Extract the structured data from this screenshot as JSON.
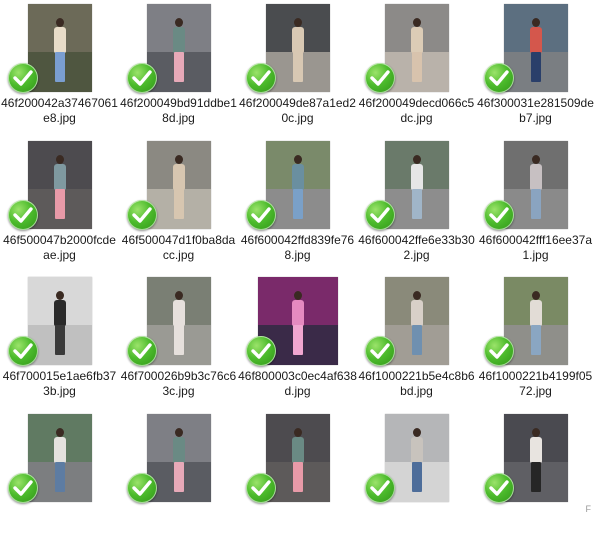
{
  "colors": {
    "check_fill": "#4cbb2c",
    "text": "#1a1a1a",
    "background": "#ffffff"
  },
  "icons": {
    "badge": "green-checkmark-icon"
  },
  "files": [
    {
      "name": "46f200042a37467061e8.jpg",
      "tones": [
        "#6c6a58",
        "#4f5640",
        "#e8dcc8",
        "#7a9ed0"
      ]
    },
    {
      "name": "46f200049bd91ddbe18d.jpg",
      "tones": [
        "#7e7f85",
        "#5a5c62",
        "#6a8a84",
        "#e7a9b8"
      ]
    },
    {
      "name": "46f200049de87a1ed20c.jpg",
      "tones": [
        "#4a4c4f",
        "#9a9690",
        "#d8c8b3",
        "#d8c8b3"
      ]
    },
    {
      "name": "46f200049decd066c5dc.jpg",
      "tones": [
        "#8c8a88",
        "#b9b2aa",
        "#dcccb6",
        "#d8c3ad"
      ]
    },
    {
      "name": "46f300031e281509deb7.jpg",
      "tones": [
        "#5c6f80",
        "#7a7e82",
        "#d4574c",
        "#2a3f6a"
      ]
    },
    {
      "name": "46f500047b2000fcdeae.jpg",
      "tones": [
        "#4d4b4f",
        "#5d5a5a",
        "#7f99a0",
        "#e89aa8"
      ]
    },
    {
      "name": "46f500047d1f0ba8dacc.jpg",
      "tones": [
        "#8b8982",
        "#b4b0a6",
        "#d7c6b0",
        "#d7c6b0"
      ]
    },
    {
      "name": "46f600042ffd839fe768.jpg",
      "tones": [
        "#7a8a6a",
        "#8c8c8c",
        "#6a8fa0",
        "#7aa0c8"
      ]
    },
    {
      "name": "46f600042ffe6e33b302.jpg",
      "tones": [
        "#6a7a6a",
        "#8d8d8d",
        "#e6e6e6",
        "#a0b5c8"
      ]
    },
    {
      "name": "46f600042fff16ee37a1.jpg",
      "tones": [
        "#6f6f6f",
        "#8a8a8a",
        "#c7c0c2",
        "#8aa4c0"
      ]
    },
    {
      "name": "46f700015e1ae6fb373b.jpg",
      "tones": [
        "#d8d8d8",
        "#c0c0c0",
        "#2a2a2a",
        "#3a3a3a"
      ]
    },
    {
      "name": "46f700026b9b3c76c63c.jpg",
      "tones": [
        "#7a7f74",
        "#9a9a94",
        "#e6e0dc",
        "#e6e0dc"
      ]
    },
    {
      "name": "46f800003c0ec4af638d.jpg",
      "tones": [
        "#7a2a6a",
        "#3a2a48",
        "#e58ac0",
        "#f0a6d0"
      ]
    },
    {
      "name": "46f1000221b5e4c8b6bd.jpg",
      "tones": [
        "#8a8a7a",
        "#a19d95",
        "#d8d0c8",
        "#6f90b0"
      ]
    },
    {
      "name": "46f1000221b4199f0572.jpg",
      "tones": [
        "#7a8a64",
        "#8f8f8a",
        "#e2dcd6",
        "#8aa6c2"
      ]
    },
    {
      "name": "",
      "tones": [
        "#607a62",
        "#7c7e80",
        "#e4e2de",
        "#5d7ca2"
      ]
    },
    {
      "name": "",
      "tones": [
        "#7e7f85",
        "#5a5c62",
        "#6a8a84",
        "#e7a9b8"
      ]
    },
    {
      "name": "",
      "tones": [
        "#4d4b4f",
        "#5d5a5a",
        "#6a8a84",
        "#e89aa8"
      ]
    },
    {
      "name": "",
      "tones": [
        "#b5b6b8",
        "#d4d4d4",
        "#c8c3bd",
        "#4d6d9a"
      ]
    },
    {
      "name": "",
      "tones": [
        "#4a4a50",
        "#5f5f64",
        "#e8e4e0",
        "#262626"
      ]
    }
  ],
  "corner_mark": "F"
}
